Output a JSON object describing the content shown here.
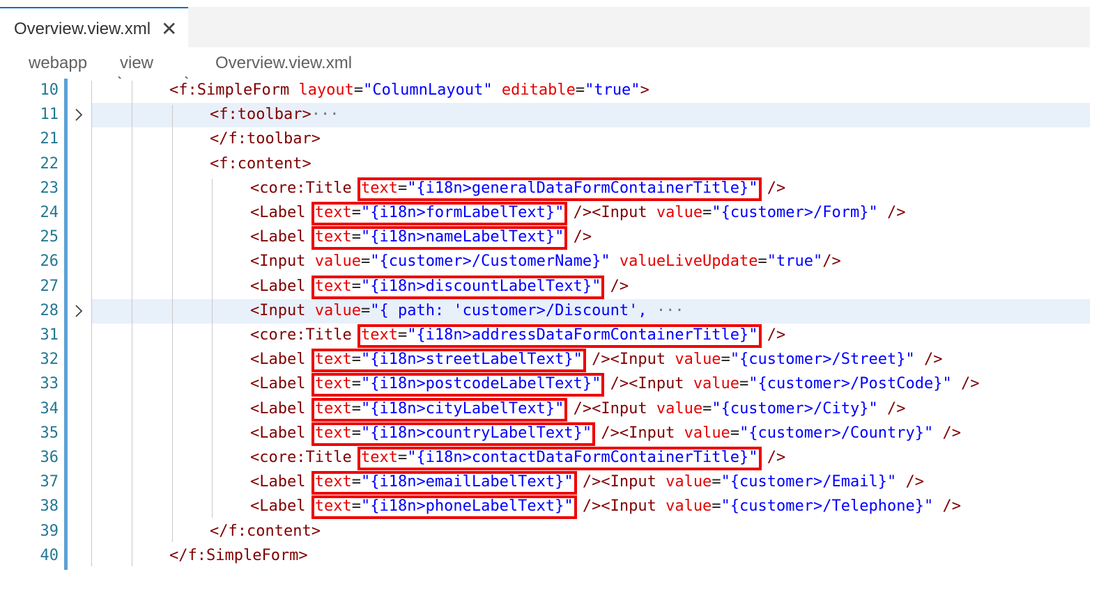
{
  "tab": {
    "title": "Overview.view.xml",
    "close_glyph": "✕"
  },
  "breadcrumb": {
    "items": [
      "webapp",
      "view",
      "Overview.view.xml"
    ],
    "separator": ">"
  },
  "editor": {
    "lines": [
      {
        "num": "10",
        "indent": 3,
        "fold": false,
        "highlight": false,
        "boxed": false,
        "tokens": [
          [
            "tag",
            "<f:SimpleForm"
          ],
          [
            "p",
            " "
          ],
          [
            "attr",
            "layout"
          ],
          [
            "p",
            "="
          ],
          [
            "val",
            "\"ColumnLayout\""
          ],
          [
            "p",
            " "
          ],
          [
            "attr",
            "editable"
          ],
          [
            "p",
            "="
          ],
          [
            "val",
            "\"true\""
          ],
          [
            "tag",
            ">"
          ]
        ]
      },
      {
        "num": "11",
        "indent": 4,
        "fold": true,
        "highlight": true,
        "boxed": false,
        "tokens": [
          [
            "tag",
            "<f:toolbar>"
          ],
          [
            "ell",
            "···"
          ]
        ]
      },
      {
        "num": "21",
        "indent": 4,
        "fold": false,
        "highlight": false,
        "boxed": false,
        "tokens": [
          [
            "tag",
            "</f:toolbar>"
          ]
        ]
      },
      {
        "num": "22",
        "indent": 4,
        "fold": false,
        "highlight": false,
        "boxed": false,
        "tokens": [
          [
            "tag",
            "<f:content>"
          ]
        ]
      },
      {
        "num": "23",
        "indent": 5,
        "fold": false,
        "highlight": false,
        "boxed": true,
        "tokens": [
          [
            "tag",
            "<core:Title"
          ],
          [
            "p",
            " "
          ],
          [
            "attr",
            "text"
          ],
          [
            "p",
            "="
          ],
          [
            "val",
            "\"{i18n>generalDataFormContainerTitle}\""
          ],
          [
            "p",
            " "
          ],
          [
            "tag",
            "/>"
          ]
        ]
      },
      {
        "num": "24",
        "indent": 5,
        "fold": false,
        "highlight": false,
        "boxed": true,
        "tokens": [
          [
            "tag",
            "<Label"
          ],
          [
            "p",
            " "
          ],
          [
            "attr",
            "text"
          ],
          [
            "p",
            "="
          ],
          [
            "val",
            "\"{i18n>formLabelText}\""
          ],
          [
            "p",
            " "
          ],
          [
            "tag",
            "/><Input"
          ],
          [
            "p",
            " "
          ],
          [
            "attr",
            "value"
          ],
          [
            "p",
            "="
          ],
          [
            "val",
            "\"{customer>/Form}\""
          ],
          [
            "p",
            " "
          ],
          [
            "tag",
            "/>"
          ]
        ]
      },
      {
        "num": "25",
        "indent": 5,
        "fold": false,
        "highlight": false,
        "boxed": true,
        "tokens": [
          [
            "tag",
            "<Label"
          ],
          [
            "p",
            " "
          ],
          [
            "attr",
            "text"
          ],
          [
            "p",
            "="
          ],
          [
            "val",
            "\"{i18n>nameLabelText}\""
          ],
          [
            "p",
            " "
          ],
          [
            "tag",
            "/>"
          ]
        ]
      },
      {
        "num": "26",
        "indent": 5,
        "fold": false,
        "highlight": false,
        "boxed": false,
        "tokens": [
          [
            "tag",
            "<Input"
          ],
          [
            "p",
            " "
          ],
          [
            "attr",
            "value"
          ],
          [
            "p",
            "="
          ],
          [
            "val",
            "\"{customer>/CustomerName}\""
          ],
          [
            "p",
            " "
          ],
          [
            "attr",
            "valueLiveUpdate"
          ],
          [
            "p",
            "="
          ],
          [
            "val",
            "\"true\""
          ],
          [
            "tag",
            "/>"
          ]
        ]
      },
      {
        "num": "27",
        "indent": 5,
        "fold": false,
        "highlight": false,
        "boxed": true,
        "tokens": [
          [
            "tag",
            "<Label"
          ],
          [
            "p",
            " "
          ],
          [
            "attr",
            "text"
          ],
          [
            "p",
            "="
          ],
          [
            "val",
            "\"{i18n>discountLabelText}\""
          ],
          [
            "p",
            " "
          ],
          [
            "tag",
            "/>"
          ]
        ]
      },
      {
        "num": "28",
        "indent": 5,
        "fold": true,
        "highlight": true,
        "boxed": false,
        "tokens": [
          [
            "tag",
            "<Input"
          ],
          [
            "p",
            " "
          ],
          [
            "attr",
            "value"
          ],
          [
            "p",
            "="
          ],
          [
            "val",
            "\"{ path: 'customer>/Discount',"
          ],
          [
            "ell",
            " ···"
          ]
        ]
      },
      {
        "num": "31",
        "indent": 5,
        "fold": false,
        "highlight": false,
        "boxed": true,
        "tokens": [
          [
            "tag",
            "<core:Title"
          ],
          [
            "p",
            " "
          ],
          [
            "attr",
            "text"
          ],
          [
            "p",
            "="
          ],
          [
            "val",
            "\"{i18n>addressDataFormContainerTitle}\""
          ],
          [
            "p",
            " "
          ],
          [
            "tag",
            "/>"
          ]
        ]
      },
      {
        "num": "32",
        "indent": 5,
        "fold": false,
        "highlight": false,
        "boxed": true,
        "tokens": [
          [
            "tag",
            "<Label"
          ],
          [
            "p",
            " "
          ],
          [
            "attr",
            "text"
          ],
          [
            "p",
            "="
          ],
          [
            "val",
            "\"{i18n>streetLabelText}\""
          ],
          [
            "p",
            " "
          ],
          [
            "tag",
            "/><Input"
          ],
          [
            "p",
            " "
          ],
          [
            "attr",
            "value"
          ],
          [
            "p",
            "="
          ],
          [
            "val",
            "\"{customer>/Street}\""
          ],
          [
            "p",
            " "
          ],
          [
            "tag",
            "/>"
          ]
        ]
      },
      {
        "num": "33",
        "indent": 5,
        "fold": false,
        "highlight": false,
        "boxed": true,
        "tokens": [
          [
            "tag",
            "<Label"
          ],
          [
            "p",
            " "
          ],
          [
            "attr",
            "text"
          ],
          [
            "p",
            "="
          ],
          [
            "val",
            "\"{i18n>postcodeLabelText}\""
          ],
          [
            "p",
            " "
          ],
          [
            "tag",
            "/><Input"
          ],
          [
            "p",
            " "
          ],
          [
            "attr",
            "value"
          ],
          [
            "p",
            "="
          ],
          [
            "val",
            "\"{customer>/PostCode}\""
          ],
          [
            "p",
            " "
          ],
          [
            "tag",
            "/>"
          ]
        ]
      },
      {
        "num": "34",
        "indent": 5,
        "fold": false,
        "highlight": false,
        "boxed": true,
        "tokens": [
          [
            "tag",
            "<Label"
          ],
          [
            "p",
            " "
          ],
          [
            "attr",
            "text"
          ],
          [
            "p",
            "="
          ],
          [
            "val",
            "\"{i18n>cityLabelText}\""
          ],
          [
            "p",
            " "
          ],
          [
            "tag",
            "/><Input"
          ],
          [
            "p",
            " "
          ],
          [
            "attr",
            "value"
          ],
          [
            "p",
            "="
          ],
          [
            "val",
            "\"{customer>/City}\""
          ],
          [
            "p",
            " "
          ],
          [
            "tag",
            "/>"
          ]
        ]
      },
      {
        "num": "35",
        "indent": 5,
        "fold": false,
        "highlight": false,
        "boxed": true,
        "tokens": [
          [
            "tag",
            "<Label"
          ],
          [
            "p",
            " "
          ],
          [
            "attr",
            "text"
          ],
          [
            "p",
            "="
          ],
          [
            "val",
            "\"{i18n>countryLabelText}\""
          ],
          [
            "p",
            " "
          ],
          [
            "tag",
            "/><Input"
          ],
          [
            "p",
            " "
          ],
          [
            "attr",
            "value"
          ],
          [
            "p",
            "="
          ],
          [
            "val",
            "\"{customer>/Country}\""
          ],
          [
            "p",
            " "
          ],
          [
            "tag",
            "/>"
          ]
        ]
      },
      {
        "num": "36",
        "indent": 5,
        "fold": false,
        "highlight": false,
        "boxed": true,
        "tokens": [
          [
            "tag",
            "<core:Title"
          ],
          [
            "p",
            " "
          ],
          [
            "attr",
            "text"
          ],
          [
            "p",
            "="
          ],
          [
            "val",
            "\"{i18n>contactDataFormContainerTitle}\""
          ],
          [
            "p",
            " "
          ],
          [
            "tag",
            "/>"
          ]
        ]
      },
      {
        "num": "37",
        "indent": 5,
        "fold": false,
        "highlight": false,
        "boxed": true,
        "tokens": [
          [
            "tag",
            "<Label"
          ],
          [
            "p",
            " "
          ],
          [
            "attr",
            "text"
          ],
          [
            "p",
            "="
          ],
          [
            "val",
            "\"{i18n>emailLabelText}\""
          ],
          [
            "p",
            " "
          ],
          [
            "tag",
            "/><Input"
          ],
          [
            "p",
            " "
          ],
          [
            "attr",
            "value"
          ],
          [
            "p",
            "="
          ],
          [
            "val",
            "\"{customer>/Email}\""
          ],
          [
            "p",
            " "
          ],
          [
            "tag",
            "/>"
          ]
        ]
      },
      {
        "num": "38",
        "indent": 5,
        "fold": false,
        "highlight": false,
        "boxed": true,
        "tokens": [
          [
            "tag",
            "<Label"
          ],
          [
            "p",
            " "
          ],
          [
            "attr",
            "text"
          ],
          [
            "p",
            "="
          ],
          [
            "val",
            "\"{i18n>phoneLabelText}\""
          ],
          [
            "p",
            " "
          ],
          [
            "tag",
            "/><Input"
          ],
          [
            "p",
            " "
          ],
          [
            "attr",
            "value"
          ],
          [
            "p",
            "="
          ],
          [
            "val",
            "\"{customer>/Telephone}\""
          ],
          [
            "p",
            " "
          ],
          [
            "tag",
            "/>"
          ]
        ]
      },
      {
        "num": "39",
        "indent": 4,
        "fold": false,
        "highlight": false,
        "boxed": false,
        "tokens": [
          [
            "tag",
            "</f:content>"
          ]
        ]
      },
      {
        "num": "40",
        "indent": 3,
        "fold": false,
        "highlight": false,
        "boxed": false,
        "tokens": [
          [
            "tag",
            "</f:SimpleForm>"
          ]
        ]
      }
    ]
  },
  "colors": {
    "tag": "#800000",
    "attr": "#e50000",
    "value": "#0000ff",
    "highlight_box": "#ee0000",
    "line_number": "#237893"
  },
  "icons": {
    "tab_close": "close-icon",
    "fold": "chevron-right-icon",
    "file_type": "xml-code-icon",
    "breadcrumb_separator": "chevron-right-icon"
  }
}
